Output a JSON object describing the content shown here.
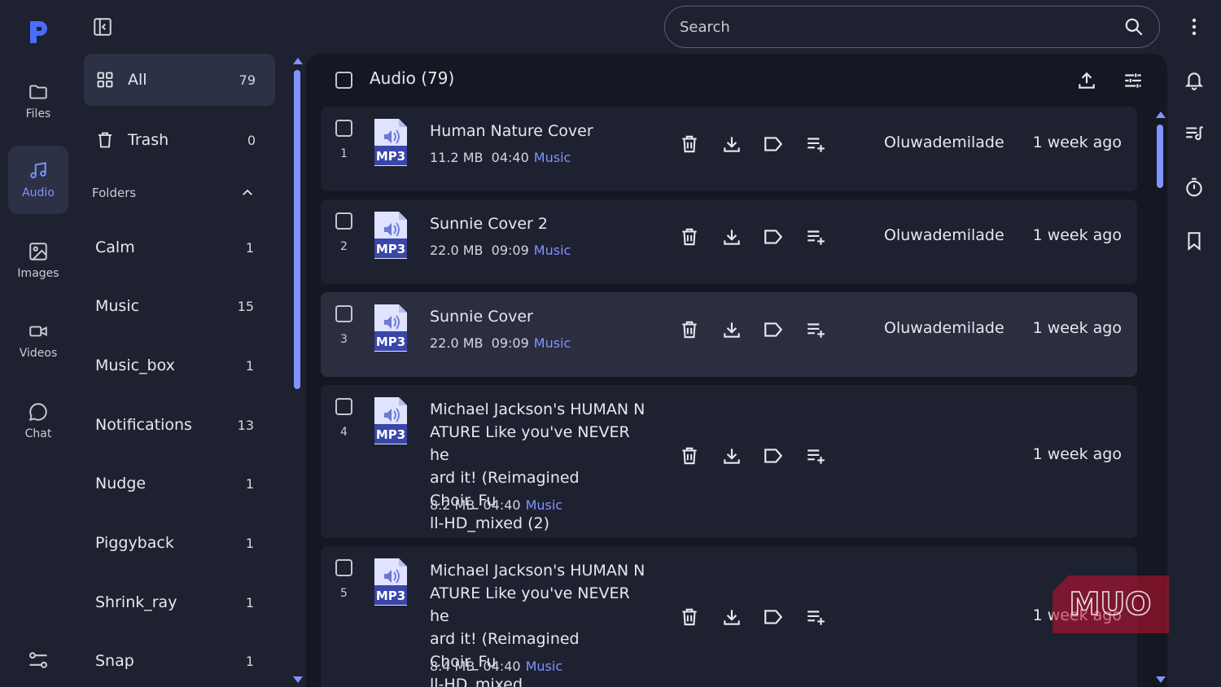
{
  "app": {
    "logo_letter": "P",
    "accent": "#8093ff"
  },
  "rail": {
    "items": [
      {
        "label": "Files",
        "icon": "folder-icon"
      },
      {
        "label": "Audio",
        "icon": "music-note-icon",
        "active": true
      },
      {
        "label": "Images",
        "icon": "image-icon"
      },
      {
        "label": "Videos",
        "icon": "video-camera-icon"
      },
      {
        "label": "Chat",
        "icon": "chat-bubble-icon"
      }
    ],
    "settings_icon": "sliders-icon"
  },
  "sidebar": {
    "all": {
      "label": "All",
      "count": "79"
    },
    "trash": {
      "label": "Trash",
      "count": "0"
    },
    "folders_heading": "Folders",
    "folders": [
      {
        "name": "Calm",
        "count": "1"
      },
      {
        "name": "Music",
        "count": "15"
      },
      {
        "name": "Music_box",
        "count": "1"
      },
      {
        "name": "Notifications",
        "count": "13"
      },
      {
        "name": "Nudge",
        "count": "1"
      },
      {
        "name": "Piggyback",
        "count": "1"
      },
      {
        "name": "Shrink_ray",
        "count": "1"
      },
      {
        "name": "Snap",
        "count": "1"
      }
    ]
  },
  "search": {
    "placeholder": "Search"
  },
  "main": {
    "title": "Audio (79)",
    "files": [
      {
        "index": "1",
        "title": "Human Nature Cover",
        "size": "11.2 MB",
        "duration": "04:40",
        "tag": "Music",
        "owner": "Oluwademilade",
        "when": "1 week ago"
      },
      {
        "index": "2",
        "title": "Sunnie Cover 2",
        "size": "22.0 MB",
        "duration": "09:09",
        "tag": "Music",
        "owner": "Oluwademilade",
        "when": "1 week ago"
      },
      {
        "index": "3",
        "title": "Sunnie Cover",
        "size": "22.0 MB",
        "duration": "09:09",
        "tag": "Music",
        "owner": "Oluwademilade",
        "when": "1 week ago"
      },
      {
        "index": "4",
        "title_lines": [
          "Michael Jackson's HUMAN N",
          "ATURE Like you've NEVER he",
          "ard it! (Reimagined Choir_Fu",
          "ll-HD_mixed (2)"
        ],
        "size": "8.2 MB",
        "duration": "04:40",
        "tag": "Music",
        "when": "1 week ago"
      },
      {
        "index": "5",
        "title_lines": [
          "Michael Jackson's HUMAN N",
          "ATURE Like you've NEVER he",
          "ard it! (Reimagined Choir_Fu",
          "ll-HD_mixed"
        ],
        "size": "8.4 MB",
        "duration": "04:40",
        "tag": "Music",
        "when": "1 week ago"
      }
    ],
    "file_badge": "MP3"
  },
  "watermark": "MUO"
}
